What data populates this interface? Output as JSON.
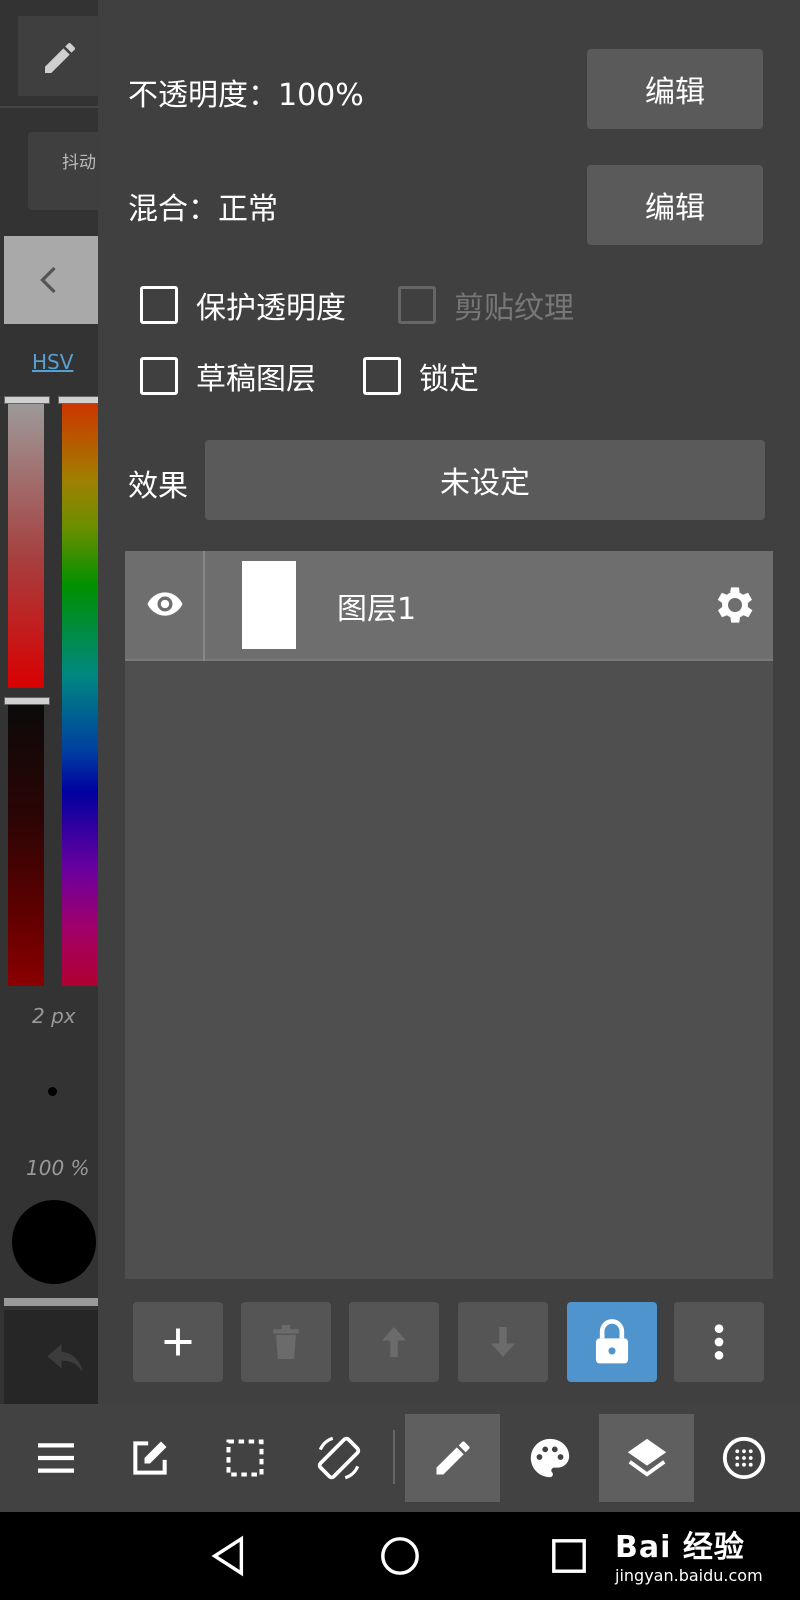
{
  "left_panel": {
    "jitter_label": "抖动",
    "color_mode": "HSV",
    "brush_size": "2 px",
    "brush_opacity": "100 %"
  },
  "layer_props": {
    "opacity_label": "不透明度：100%",
    "opacity_edit": "编辑",
    "blend_label": "混合：正常",
    "blend_edit": "编辑",
    "checkboxes": [
      {
        "label": "保护透明度",
        "checked": false,
        "enabled": true
      },
      {
        "label": "剪贴纹理",
        "checked": false,
        "enabled": false
      },
      {
        "label": "草稿图层",
        "checked": false,
        "enabled": true
      },
      {
        "label": "锁定",
        "checked": false,
        "enabled": true
      }
    ],
    "effect_label": "效果",
    "effect_value": "未设定"
  },
  "layers": [
    {
      "name": "图层1",
      "visible": true
    }
  ],
  "layer_actions": [
    "add-icon",
    "trash-icon",
    "arrow-up-icon",
    "arrow-down-icon",
    "lock-icon",
    "more-vertical-icon"
  ],
  "toolbar": {
    "items": [
      "menu-icon",
      "edit-canvas-icon",
      "selection-icon",
      "rotate-icon",
      "pen-icon",
      "palette-icon",
      "layers-icon",
      "grid-icon"
    ],
    "selected": [
      "pen-icon",
      "layers-icon"
    ]
  },
  "navbar": {
    "items": [
      "back-icon",
      "home-icon",
      "recents-icon"
    ],
    "watermark_logo": "Bai 经验",
    "watermark_url": "jingyan.baidu.com"
  },
  "colors": {
    "accent": "#4f94cd",
    "link": "#57a0d3",
    "panel_bg": "#404040",
    "button_bg": "#5a5a5a"
  }
}
